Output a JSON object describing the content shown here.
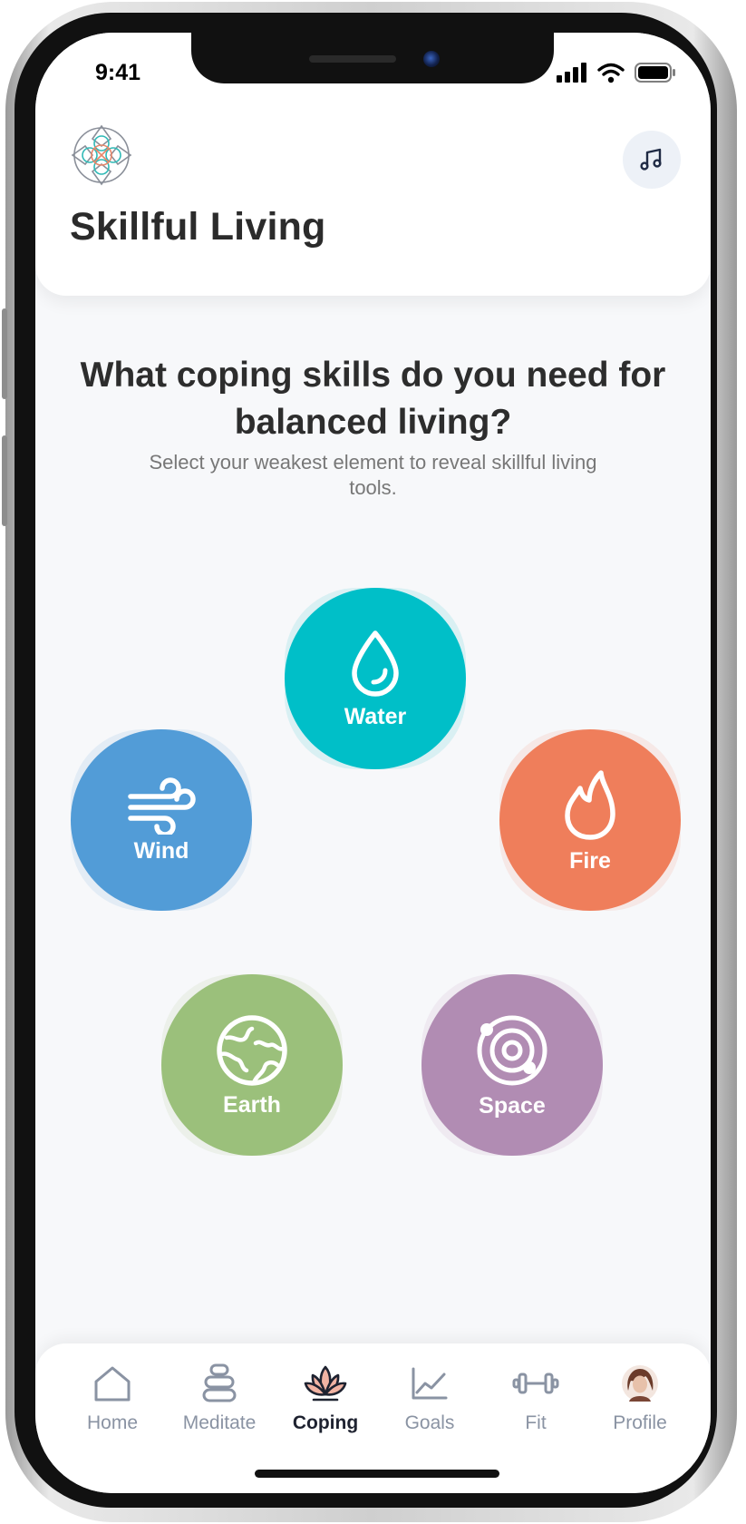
{
  "status_bar": {
    "time": "9:41"
  },
  "header": {
    "title": "Skillful Living",
    "logo_icon": "mandala-logo-icon",
    "music_icon": "music-note-icon"
  },
  "prompt": {
    "question": "What coping skills do you need for balanced living?",
    "subtitle": "Select your weakest element to reveal skillful living tools."
  },
  "elements": [
    {
      "label": "Water",
      "icon": "water-drop-icon",
      "color": "#00bfc8"
    },
    {
      "label": "Wind",
      "icon": "wind-icon",
      "color": "#529cd7"
    },
    {
      "label": "Fire",
      "icon": "flame-icon",
      "color": "#ef7e5b"
    },
    {
      "label": "Earth",
      "icon": "globe-icon",
      "color": "#9bc07b"
    },
    {
      "label": "Space",
      "icon": "orbit-icon",
      "color": "#b18cb3"
    }
  ],
  "tabs": [
    {
      "label": "Home",
      "icon": "home-icon",
      "active": false
    },
    {
      "label": "Meditate",
      "icon": "stones-icon",
      "active": false
    },
    {
      "label": "Coping",
      "icon": "lotus-icon",
      "active": true
    },
    {
      "label": "Goals",
      "icon": "chart-line-icon",
      "active": false
    },
    {
      "label": "Fit",
      "icon": "dumbbell-icon",
      "active": false
    },
    {
      "label": "Profile",
      "icon": "profile-avatar",
      "active": false
    }
  ],
  "colors": {
    "title_text": "#2b2b2b",
    "tab_inactive": "#8a93a3",
    "tab_active": "#1e2230",
    "background": "#f7f8fa"
  }
}
